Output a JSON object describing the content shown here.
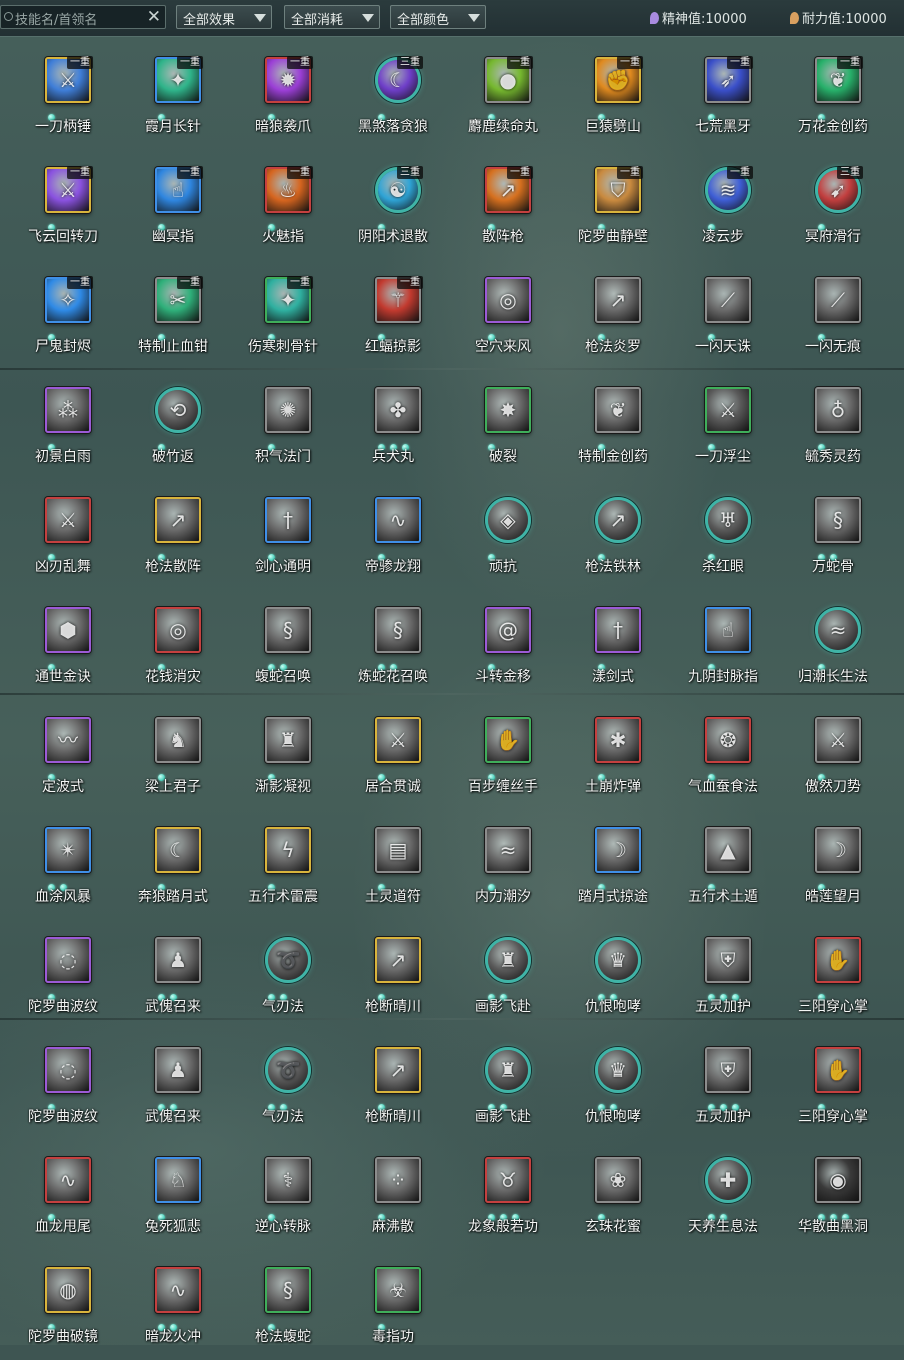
{
  "topbar": {
    "search_placeholder": "技能名/首领名",
    "clear_label": "✕",
    "filters": [
      "全部效果",
      "全部消耗",
      "全部颜色"
    ],
    "spirit_label": "精神值:10000",
    "stamina_label": "耐力值:10000",
    "colors": {
      "spirit_icon": "#a98be0",
      "stamina_icon": "#d9a060"
    }
  },
  "frame_colors": {
    "gold": "#d8b43c",
    "blue": "#3f8fe6",
    "purple": "#9b5ad6",
    "red": "#c4403f",
    "green": "#3fae5a",
    "gray": "#8c8c8c",
    "teal": "#3fb4a7"
  },
  "skills": [
    {
      "name": "一刀柄锤",
      "frame": "gold",
      "dots": 1,
      "badge": "一重",
      "art": "#3f7ed8",
      "icon": "blade-icon"
    },
    {
      "name": "霞月长针",
      "frame": "blue",
      "dots": 1,
      "badge": "一重",
      "art": "#2fb48a",
      "icon": "needle-icon"
    },
    {
      "name": "暗狼袭爪",
      "frame": "red",
      "dots": 1,
      "badge": "一重",
      "art": "#9b3fd6",
      "icon": "claw-icon"
    },
    {
      "name": "黑煞落贪狼",
      "frame": "teal",
      "dots": 1,
      "badge": "三重",
      "art": "#6f3fc9",
      "icon": "wolf-icon"
    },
    {
      "name": "麝鹿续命丸",
      "frame": "gray",
      "dots": 1,
      "badge": "一重",
      "art": "#76b82f",
      "icon": "pill-icon"
    },
    {
      "name": "巨猿劈山",
      "frame": "gold",
      "dots": 1,
      "badge": "一重",
      "art": "#e08a1f",
      "icon": "ape-icon"
    },
    {
      "name": "七荒黑牙",
      "frame": "gray",
      "dots": 1,
      "badge": "一重",
      "art": "#3a4fc9",
      "icon": "fang-icon"
    },
    {
      "name": "万花金创药",
      "frame": "gray",
      "dots": 1,
      "badge": "一重",
      "art": "#27b06a",
      "icon": "herb-icon"
    },
    {
      "name": "飞云回转刀",
      "frame": "gold",
      "dots": 1,
      "badge": "一重",
      "art": "#8a52e0",
      "icon": "blade-icon"
    },
    {
      "name": "幽冥指",
      "frame": "blue",
      "dots": 1,
      "badge": "一重",
      "art": "#2f86e0",
      "icon": "finger-icon"
    },
    {
      "name": "火魅指",
      "frame": "red",
      "dots": 1,
      "badge": "一重",
      "art": "#d6651f",
      "icon": "flame-icon"
    },
    {
      "name": "阴阳术退散",
      "frame": "teal",
      "dots": 1,
      "badge": "三重",
      "art": "#2fa4d6",
      "icon": "yinyang-icon"
    },
    {
      "name": "散阵枪",
      "frame": "red",
      "dots": 1,
      "badge": "一重",
      "art": "#d6701f",
      "icon": "spear-icon"
    },
    {
      "name": "陀罗曲静壁",
      "frame": "gold",
      "dots": 1,
      "badge": "一重",
      "art": "#c98a3f",
      "icon": "shield-icon"
    },
    {
      "name": "凌云步",
      "frame": "teal",
      "dots": 1,
      "badge": "一重",
      "art": "#3f5fd6",
      "icon": "step-icon"
    },
    {
      "name": "冥府滑行",
      "frame": "teal",
      "dots": 1,
      "badge": "三重",
      "art": "#c23f3f",
      "icon": "glide-icon"
    },
    {
      "name": "尸鬼封烬",
      "frame": "blue",
      "dots": 1,
      "badge": "一重",
      "art": "#2f8ae6",
      "icon": "ghost-icon"
    },
    {
      "name": "特制止血钳",
      "frame": "gray",
      "dots": 1,
      "badge": "一重",
      "art": "#2fb07a",
      "icon": "clamp-icon"
    },
    {
      "name": "伤寒刺骨针",
      "frame": "green",
      "dots": 1,
      "badge": "一重",
      "art": "#2fb0a0",
      "icon": "needle-icon"
    },
    {
      "name": "红蝠掠影",
      "frame": "gray",
      "dots": 1,
      "badge": "一重",
      "art": "#c23a2f",
      "icon": "bat-icon"
    },
    {
      "name": "空穴来风",
      "frame": "purple",
      "dots": 1,
      "badge": "",
      "art": "#6a6a6a",
      "icon": "coin-icon"
    },
    {
      "name": "枪法炎罗",
      "frame": "gray",
      "dots": 1,
      "badge": "",
      "art": "#6a6a6a",
      "icon": "spear-icon"
    },
    {
      "name": "一闪天诛",
      "frame": "gray",
      "dots": 1,
      "badge": "",
      "art": "#6a6a6a",
      "icon": "slash-icon"
    },
    {
      "name": "一闪无痕",
      "frame": "gray",
      "dots": 1,
      "badge": "",
      "art": "#6a6a6a",
      "icon": "slash-icon"
    },
    {
      "name": "初景白雨",
      "frame": "purple",
      "dots": 1,
      "badge": "",
      "art": "#6a6a6a",
      "icon": "rain-icon"
    },
    {
      "name": "破竹返",
      "frame": "teal",
      "dots": 1,
      "badge": "",
      "art": "#5a5a5a",
      "icon": "counter-icon"
    },
    {
      "name": "积气法门",
      "frame": "gray",
      "dots": 1,
      "badge": "",
      "art": "#6a6a6a",
      "icon": "qi-icon"
    },
    {
      "name": "兵犬丸",
      "frame": "gray",
      "dots": 3,
      "badge": "",
      "art": "#6a6a6a",
      "icon": "dog-icon"
    },
    {
      "name": "破裂",
      "frame": "green",
      "dots": 1,
      "badge": "",
      "art": "#6a6a6a",
      "icon": "burst-icon"
    },
    {
      "name": "特制金创药",
      "frame": "gray",
      "dots": 1,
      "badge": "",
      "art": "#6a6a6a",
      "icon": "herb-icon"
    },
    {
      "name": "一刀浮尘",
      "frame": "green",
      "dots": 1,
      "badge": "",
      "art": "#5a5a5a",
      "icon": "blade-icon"
    },
    {
      "name": "毓秀灵药",
      "frame": "gray",
      "dots": 1,
      "badge": "",
      "art": "#6a6a6a",
      "icon": "gourd-icon"
    },
    {
      "name": "凶刃乱舞",
      "frame": "red",
      "dots": 1,
      "badge": "",
      "art": "#6a6a6a",
      "icon": "blade-icon"
    },
    {
      "name": "枪法散阵",
      "frame": "gold",
      "dots": 1,
      "badge": "",
      "art": "#6a6a6a",
      "icon": "spear-icon"
    },
    {
      "name": "剑心通明",
      "frame": "blue",
      "dots": 1,
      "badge": "",
      "art": "#6a6a6a",
      "icon": "sword-icon"
    },
    {
      "name": "帝骖龙翔",
      "frame": "blue",
      "dots": 1,
      "badge": "",
      "art": "#6a6a6a",
      "icon": "dragon-icon"
    },
    {
      "name": "顽抗",
      "frame": "teal",
      "dots": 1,
      "badge": "",
      "art": "#5a5a5a",
      "icon": "resist-icon"
    },
    {
      "name": "枪法铁林",
      "frame": "teal",
      "dots": 1,
      "badge": "",
      "art": "#5a5a5a",
      "icon": "spear-icon"
    },
    {
      "name": "杀红眼",
      "frame": "teal",
      "dots": 1,
      "badge": "",
      "art": "#5a5a5a",
      "icon": "rage-icon"
    },
    {
      "name": "万蛇骨",
      "frame": "gray",
      "dots": 2,
      "badge": "",
      "art": "#6a6a6a",
      "icon": "snake-icon"
    },
    {
      "name": "通世金诀",
      "frame": "purple",
      "dots": 1,
      "badge": "",
      "art": "#6a6a6a",
      "icon": "dice-icon"
    },
    {
      "name": "花钱消灾",
      "frame": "red",
      "dots": 1,
      "badge": "",
      "art": "#6a6a6a",
      "icon": "coin-icon"
    },
    {
      "name": "蝮蛇召唤",
      "frame": "gray",
      "dots": 2,
      "badge": "",
      "art": "#6a6a6a",
      "icon": "snake-icon"
    },
    {
      "name": "炼蛇花召唤",
      "frame": "gray",
      "dots": 2,
      "badge": "",
      "art": "#6a6a6a",
      "icon": "snake-icon"
    },
    {
      "name": "斗转金移",
      "frame": "purple",
      "dots": 1,
      "badge": "",
      "art": "#6a6a6a",
      "icon": "swirl-icon"
    },
    {
      "name": "漾剑式",
      "frame": "purple",
      "dots": 1,
      "badge": "",
      "art": "#6a6a6a",
      "icon": "sword-icon"
    },
    {
      "name": "九阴封脉指",
      "frame": "blue",
      "dots": 1,
      "badge": "",
      "art": "#6a6a6a",
      "icon": "finger-icon"
    },
    {
      "name": "归潮长生法",
      "frame": "teal",
      "dots": 1,
      "badge": "",
      "art": "#5a5a5a",
      "icon": "tide-icon"
    },
    {
      "name": "定波式",
      "frame": "purple",
      "dots": 1,
      "badge": "",
      "art": "#6a6a6a",
      "icon": "wave-icon"
    },
    {
      "name": "梁上君子",
      "frame": "gray",
      "dots": 1,
      "badge": "",
      "art": "#6a6a6a",
      "icon": "thief-icon"
    },
    {
      "name": "渐影凝视",
      "frame": "gray",
      "dots": 1,
      "badge": "",
      "art": "#6a6a6a",
      "icon": "shadow-icon"
    },
    {
      "name": "居合贯诚",
      "frame": "gold",
      "dots": 1,
      "badge": "",
      "art": "#6a6a6a",
      "icon": "blade-icon"
    },
    {
      "name": "百步缠丝手",
      "frame": "green",
      "dots": 1,
      "badge": "",
      "art": "#6a6a6a",
      "icon": "hand-icon"
    },
    {
      "name": "土崩炸弹",
      "frame": "red",
      "dots": 1,
      "badge": "",
      "art": "#6a6a6a",
      "icon": "bomb-icon"
    },
    {
      "name": "气血蚕食法",
      "frame": "red",
      "dots": 1,
      "badge": "",
      "art": "#6a6a6a",
      "icon": "drain-icon"
    },
    {
      "name": "傲然刀势",
      "frame": "gray",
      "dots": 1,
      "badge": "",
      "art": "#6a6a6a",
      "icon": "blade-icon"
    },
    {
      "name": "血涂风暴",
      "frame": "blue",
      "dots": 2,
      "badge": "",
      "art": "#6a6a6a",
      "icon": "storm-icon"
    },
    {
      "name": "奔狼踏月式",
      "frame": "gold",
      "dots": 1,
      "badge": "",
      "art": "#6a6a6a",
      "icon": "wolf-icon"
    },
    {
      "name": "五行术雷震",
      "frame": "gold",
      "dots": 1,
      "badge": "",
      "art": "#6a6a6a",
      "icon": "thunder-icon"
    },
    {
      "name": "土灵道符",
      "frame": "gray",
      "dots": 1,
      "badge": "",
      "art": "#6a6a6a",
      "icon": "talisman-icon"
    },
    {
      "name": "内力潮汐",
      "frame": "gray",
      "dots": 1,
      "badge": "",
      "art": "#6a6a6a",
      "icon": "tide-icon"
    },
    {
      "name": "踏月式掠途",
      "frame": "blue",
      "dots": 1,
      "badge": "",
      "art": "#6a6a6a",
      "icon": "moon-icon"
    },
    {
      "name": "五行术土遁",
      "frame": "gray",
      "dots": 1,
      "badge": "",
      "art": "#6a6a6a",
      "icon": "earth-icon"
    },
    {
      "name": "皓莲望月",
      "frame": "gray",
      "dots": 1,
      "badge": "",
      "art": "#6a6a6a",
      "icon": "moon-icon"
    },
    {
      "name": "陀罗曲波纹",
      "frame": "purple",
      "dots": 1,
      "badge": "",
      "art": "#6a6a6a",
      "icon": "ripple-icon"
    },
    {
      "name": "武傀召来",
      "frame": "gray",
      "dots": 2,
      "badge": "",
      "art": "#6a6a6a",
      "icon": "puppet-icon"
    },
    {
      "name": "气刃法",
      "frame": "teal",
      "dots": 2,
      "badge": "",
      "art": "#5a5a5a",
      "icon": "wind-blade-icon"
    },
    {
      "name": "枪断晴川",
      "frame": "gold",
      "dots": 1,
      "badge": "",
      "art": "#6a6a6a",
      "icon": "spear-icon"
    },
    {
      "name": "画影飞赴",
      "frame": "teal",
      "dots": 2,
      "badge": "",
      "art": "#5a5a5a",
      "icon": "shadow-icon"
    },
    {
      "name": "仇恨咆哮",
      "frame": "teal",
      "dots": 2,
      "badge": "",
      "art": "#5a5a5a",
      "icon": "roar-icon"
    },
    {
      "name": "五灵加护",
      "frame": "gray",
      "dots": 3,
      "badge": "",
      "art": "#6a6a6a",
      "icon": "guard-icon"
    },
    {
      "name": "三阳穿心掌",
      "frame": "red",
      "dots": 1,
      "badge": "",
      "art": "#6a6a6a",
      "icon": "palm-icon"
    },
    {
      "name": "陀罗曲波纹",
      "frame": "purple",
      "dots": 1,
      "badge": "",
      "art": "#6a6a6a",
      "icon": "ripple-icon"
    },
    {
      "name": "武傀召来",
      "frame": "gray",
      "dots": 2,
      "badge": "",
      "art": "#6a6a6a",
      "icon": "puppet-icon"
    },
    {
      "name": "气刃法",
      "frame": "teal",
      "dots": 2,
      "badge": "",
      "art": "#5a5a5a",
      "icon": "wind-blade-icon"
    },
    {
      "name": "枪断晴川",
      "frame": "gold",
      "dots": 1,
      "badge": "",
      "art": "#6a6a6a",
      "icon": "spear-icon"
    },
    {
      "name": "画影飞赴",
      "frame": "teal",
      "dots": 2,
      "badge": "",
      "art": "#5a5a5a",
      "icon": "shadow-icon"
    },
    {
      "name": "仇恨咆哮",
      "frame": "teal",
      "dots": 2,
      "badge": "",
      "art": "#5a5a5a",
      "icon": "roar-icon"
    },
    {
      "name": "五灵加护",
      "frame": "gray",
      "dots": 3,
      "badge": "",
      "art": "#6a6a6a",
      "icon": "guard-icon"
    },
    {
      "name": "三阳穿心掌",
      "frame": "red",
      "dots": 1,
      "badge": "",
      "art": "#6a6a6a",
      "icon": "palm-icon"
    },
    {
      "name": "血龙甩尾",
      "frame": "red",
      "dots": 1,
      "badge": "",
      "art": "#6a6a6a",
      "icon": "dragon-icon"
    },
    {
      "name": "兔死狐悲",
      "frame": "blue",
      "dots": 1,
      "badge": "",
      "art": "#6a6a6a",
      "icon": "fox-icon"
    },
    {
      "name": "逆心转脉",
      "frame": "gray",
      "dots": 1,
      "badge": "",
      "art": "#6a6a6a",
      "icon": "meridian-icon"
    },
    {
      "name": "麻沸散",
      "frame": "gray",
      "dots": 1,
      "badge": "",
      "art": "#6a6a6a",
      "icon": "powder-icon"
    },
    {
      "name": "龙象般若功",
      "frame": "red",
      "dots": 3,
      "badge": "",
      "art": "#6a6a6a",
      "icon": "elephant-icon"
    },
    {
      "name": "玄珠花蜜",
      "frame": "gray",
      "dots": 1,
      "badge": "",
      "art": "#6a6a6a",
      "icon": "flower-icon"
    },
    {
      "name": "天养生息法",
      "frame": "teal",
      "dots": 2,
      "badge": "",
      "art": "#5a5a5a",
      "icon": "heal-icon"
    },
    {
      "name": "华散曲黑洞",
      "frame": "gray",
      "dots": 3,
      "badge": "",
      "art": "#3a3a3a",
      "icon": "blackhole-icon"
    },
    {
      "name": "陀罗曲破镜",
      "frame": "gold",
      "dots": 1,
      "badge": "",
      "art": "#6a6a6a",
      "icon": "mirror-icon"
    },
    {
      "name": "暗龙火冲",
      "frame": "red",
      "dots": 2,
      "badge": "",
      "art": "#6a6a6a",
      "icon": "dragon-icon"
    },
    {
      "name": "枪法蝮蛇",
      "frame": "green",
      "dots": 1,
      "badge": "",
      "art": "#6a6a6a",
      "icon": "snake-icon"
    },
    {
      "name": "毒指功",
      "frame": "green",
      "dots": 1,
      "badge": "",
      "art": "#6a6a6a",
      "icon": "poison-icon"
    }
  ]
}
